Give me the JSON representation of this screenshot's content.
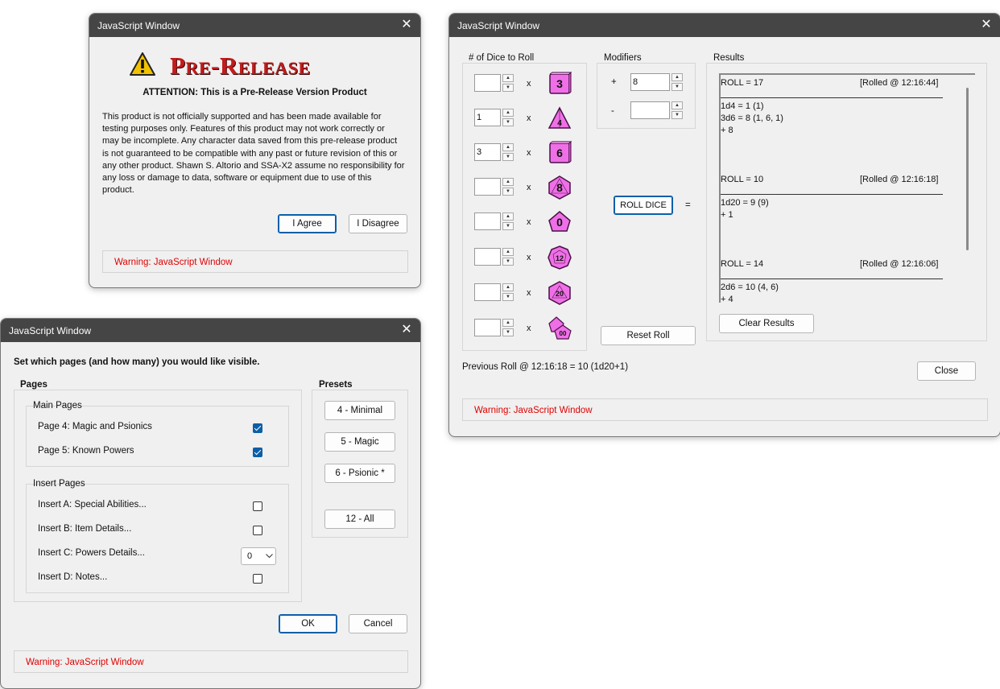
{
  "prerelease": {
    "window_title": "JavaScript Window",
    "logo_text": "Pre-Release",
    "attention": "ATTENTION: This is a Pre-Release Version Product",
    "body_lines": [
      "This product is not officially supported and has been made available for",
      "testing purposes only. Features of this product may not work correctly or",
      "may be incomplete. Any character data saved from this pre-release product",
      "is not guaranteed to be compatible with any past or future revision of this or",
      "any other product. Shawn S. Altorio and SSA-X2 assume no responsibility for",
      "any loss or damage to data, software or equipment due to use of this",
      "product."
    ],
    "agree_label": "I Agree",
    "disagree_label": "I Disagree",
    "warning": "Warning: JavaScript Window"
  },
  "pages": {
    "window_title": "JavaScript Window",
    "instruction": "Set which pages (and how many) you would like visible.",
    "pages_group": "Pages",
    "main_group": "Main Pages",
    "main_items": [
      {
        "label": "Page 4: Magic and Psionics",
        "checked": true
      },
      {
        "label": "Page 5: Known Powers",
        "checked": true
      }
    ],
    "insert_group": "Insert Pages",
    "insert_items": [
      {
        "label": "Insert A: Special Abilities...",
        "checked": false
      },
      {
        "label": "Insert B: Item Details...",
        "checked": false
      },
      {
        "label": "Insert C: Powers Details...",
        "select_value": "0"
      },
      {
        "label": "Insert D: Notes...",
        "checked": false
      }
    ],
    "presets_group": "Presets",
    "presets": [
      "4 - Minimal",
      "5 - Magic",
      "6 - Psionic *",
      "12 - All"
    ],
    "ok_label": "OK",
    "cancel_label": "Cancel",
    "warning": "Warning: JavaScript Window"
  },
  "dice": {
    "window_title": "JavaScript Window",
    "num_dice_group": "# of Dice to Roll",
    "mult_symbol": "x",
    "rows": [
      {
        "value": "",
        "die_label": "3",
        "die": "d3"
      },
      {
        "value": "1",
        "die_label": "4",
        "die": "d4"
      },
      {
        "value": "3",
        "die_label": "6",
        "die": "d6"
      },
      {
        "value": "",
        "die_label": "8",
        "die": "d8"
      },
      {
        "value": "",
        "die_label": "0",
        "die": "d10"
      },
      {
        "value": "",
        "die_label": "12",
        "die": "d12"
      },
      {
        "value": "",
        "die_label": "20",
        "die": "d20"
      },
      {
        "value": "",
        "die_label": "00",
        "die": "d100"
      }
    ],
    "modifiers_group": "Modifiers",
    "plus_symbol": "+",
    "minus_symbol": "-",
    "plus_value": "8",
    "minus_value": "",
    "roll_label": "ROLL DICE",
    "equals": "=",
    "reset_label": "Reset Roll",
    "results_group": "Results",
    "results": [
      {
        "roll": "ROLL = 17",
        "rolled": "[Rolled @ 12:16:44]",
        "lines": [
          "1d4 = 1 (1)",
          "3d6 = 8 (1, 6, 1)",
          "+ 8"
        ]
      },
      {
        "roll": "ROLL = 10",
        "rolled": "[Rolled @ 12:16:18]",
        "lines": [
          "1d20 = 9 (9)",
          "+ 1"
        ]
      },
      {
        "roll": "ROLL = 14",
        "rolled": "[Rolled @ 12:16:06]",
        "lines": [
          "2d6 = 10 (4, 6)",
          "+ 4"
        ]
      }
    ],
    "clear_label": "Clear Results",
    "previous_roll": "Previous Roll @ 12:16:18 = 10 (1d20+1)",
    "close_label": "Close",
    "warning": "Warning: JavaScript Window"
  }
}
